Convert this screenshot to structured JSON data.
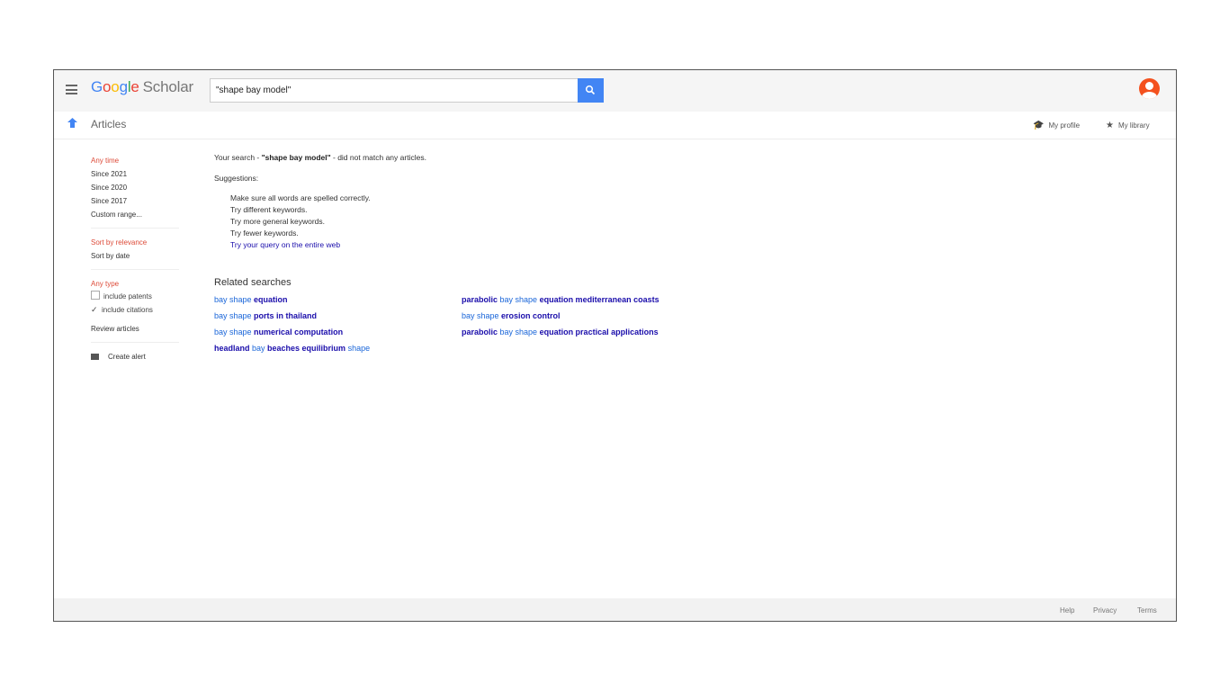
{
  "header": {
    "logo_google": [
      "G",
      "o",
      "o",
      "g",
      "l",
      "e"
    ],
    "logo_scholar": "Scholar",
    "search_value": "\"shape bay model\""
  },
  "subheader": {
    "title": "Articles",
    "my_profile": "My profile",
    "my_library": "My library"
  },
  "sidebar": {
    "time_items": [
      "Any time",
      "Since 2021",
      "Since 2020",
      "Since 2017",
      "Custom range..."
    ],
    "sort_items": [
      "Sort by relevance",
      "Sort by date"
    ],
    "type_item": "Any type",
    "include_patents": "include patents",
    "include_citations": "include citations",
    "review_articles": "Review articles",
    "create_alert": "Create alert"
  },
  "main": {
    "notfound_prefix": "Your search - ",
    "notfound_query": "\"shape bay model\"",
    "notfound_suffix": " - did not match any articles.",
    "suggestions_title": "Suggestions:",
    "suggestions": [
      "Make sure all words are spelled correctly.",
      "Try different keywords.",
      "Try more general keywords.",
      "Try fewer keywords."
    ],
    "web_link": "Try your query on the entire web",
    "related_title": "Related searches",
    "related_col1": [
      [
        {
          "t": "bay shape ",
          "b": false
        },
        {
          "t": "equation",
          "b": true
        }
      ],
      [
        {
          "t": "bay shape ",
          "b": false
        },
        {
          "t": "ports in thailand",
          "b": true
        }
      ],
      [
        {
          "t": "bay shape ",
          "b": false
        },
        {
          "t": "numerical computation",
          "b": true
        }
      ],
      [
        {
          "t": "headland",
          "b": true
        },
        {
          "t": " bay ",
          "b": false
        },
        {
          "t": "beaches equilibrium",
          "b": true
        },
        {
          "t": " shape",
          "b": false
        }
      ]
    ],
    "related_col2": [
      [
        {
          "t": "parabolic",
          "b": true
        },
        {
          "t": " bay shape ",
          "b": false
        },
        {
          "t": "equation mediterranean coasts",
          "b": true
        }
      ],
      [
        {
          "t": "bay shape ",
          "b": false
        },
        {
          "t": "erosion control",
          "b": true
        }
      ],
      [
        {
          "t": "parabolic",
          "b": true
        },
        {
          "t": " bay shape ",
          "b": false
        },
        {
          "t": "equation practical applications",
          "b": true
        }
      ]
    ]
  },
  "footer": {
    "help": "Help",
    "privacy": "Privacy",
    "terms": "Terms"
  },
  "colors": {
    "accent_blue": "#4285f4",
    "link": "#1a0dab",
    "active_red": "#dd4b39",
    "avatar": "#f4511e"
  }
}
